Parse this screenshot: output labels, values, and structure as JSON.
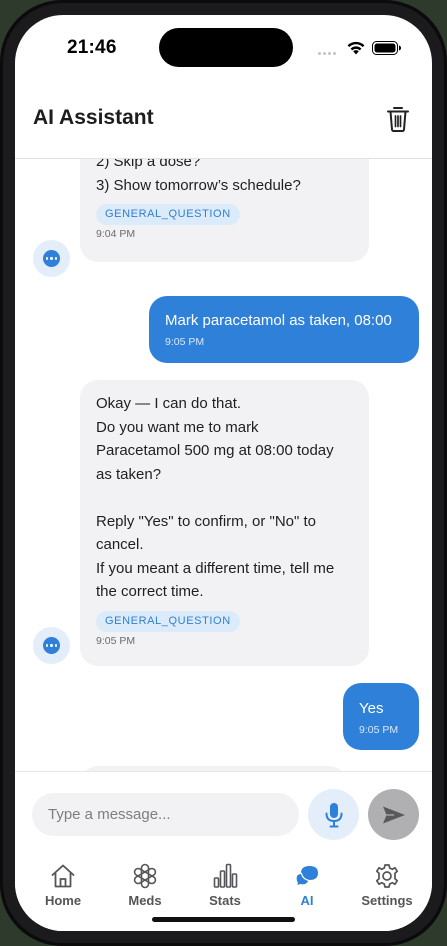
{
  "status_bar": {
    "time": "21:46"
  },
  "header": {
    "title": "AI Assistant",
    "clear_icon": "trash-icon"
  },
  "messages": [
    {
      "role": "assistant",
      "lines": [
        "2) Skip a dose?",
        "3) Show tomorrow’s schedule?"
      ],
      "tag": "GENERAL_QUESTION",
      "time": "9:04 PM"
    },
    {
      "role": "user",
      "text": "Mark paracetamol as taken, 08:00",
      "time": "9:05 PM"
    },
    {
      "role": "assistant",
      "lines": [
        "Okay — I can do that.",
        "Do you want me to mark",
        "Paracetamol 500 mg at 08:00 today",
        "as taken?",
        "",
        "Reply \"Yes\" to confirm, or \"No\" to",
        "cancel.",
        "If you meant a different time, tell me",
        "the correct time."
      ],
      "tag": "GENERAL_QUESTION",
      "time": "9:05 PM"
    },
    {
      "role": "user",
      "text": "Yes",
      "time": "9:05 PM"
    }
  ],
  "composer": {
    "placeholder": "Type a message...",
    "mic_icon": "microphone-icon",
    "send_icon": "send-icon"
  },
  "tabs": [
    {
      "label": "Home",
      "icon": "home-icon",
      "active": false
    },
    {
      "label": "Meds",
      "icon": "pill-icon",
      "active": false
    },
    {
      "label": "Stats",
      "icon": "bar-chart-icon",
      "active": false
    },
    {
      "label": "AI",
      "icon": "chat-bubble-icon",
      "active": true
    },
    {
      "label": "Settings",
      "icon": "gear-icon",
      "active": false
    }
  ],
  "colors": {
    "accent": "#2f80d8",
    "ai_bubble": "#f2f2f4",
    "tag_bg": "#dcebfa",
    "send_disabled": "#b0b0b3"
  }
}
